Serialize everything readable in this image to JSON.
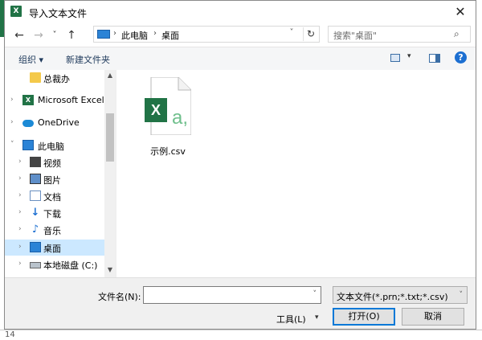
{
  "dialog": {
    "title": "导入文本文件",
    "title_icon": "X",
    "close_glyph": "✕"
  },
  "nav": {
    "back": "←",
    "forward": "→",
    "recent": "˅",
    "up": "↑"
  },
  "address": {
    "crumbs": [
      "此电脑",
      "桌面"
    ],
    "separator": "›",
    "dropdown": "˅",
    "refresh": "↻"
  },
  "search": {
    "placeholder": "搜索\"桌面\"",
    "icon": "⌕"
  },
  "toolbar": {
    "organize": "组织 ▾",
    "new_folder": "新建文件夹",
    "view_dropdown": "▾",
    "help": "?"
  },
  "sidebar": {
    "items": [
      {
        "label": "总裁办",
        "icon": "folder-icon",
        "expandable": false
      },
      {
        "label": "Microsoft Excel",
        "icon": "excel-icon",
        "expandable": true
      },
      {
        "label": "OneDrive",
        "icon": "onedrive-icon",
        "expandable": true
      },
      {
        "label": "此电脑",
        "icon": "computer-icon",
        "expandable": true,
        "expanded": true
      },
      {
        "label": "视频",
        "icon": "video-icon",
        "expandable": true
      },
      {
        "label": "图片",
        "icon": "pictures-icon",
        "expandable": true
      },
      {
        "label": "文档",
        "icon": "documents-icon",
        "expandable": true
      },
      {
        "label": "下载",
        "icon": "downloads-icon",
        "expandable": true
      },
      {
        "label": "音乐",
        "icon": "music-icon",
        "expandable": true
      },
      {
        "label": "桌面",
        "icon": "desktop-icon",
        "expandable": true,
        "selected": true
      },
      {
        "label": "本地磁盘 (C:)",
        "icon": "disk-icon",
        "expandable": true
      }
    ],
    "scroll_up": "▲",
    "scroll_down": "▼"
  },
  "files": [
    {
      "name": "示例.csv",
      "icon": "excel-csv-file-icon",
      "badge": "X",
      "letter": "a,"
    }
  ],
  "footer": {
    "filename_label": "文件名(N):",
    "filename_value": "",
    "filename_dropdown": "˅",
    "filetype_value": "文本文件(*.prn;*.txt;*.csv)",
    "filetype_dropdown": "˅",
    "tools_label": "工具(L)",
    "tools_dropdown": "▾",
    "open_label": "打开(O)",
    "cancel_label": "取消"
  },
  "background": {
    "row_number": "14"
  },
  "colors": {
    "excel_green": "#217346",
    "selection": "#cce8ff",
    "accent_blue": "#0078d7"
  }
}
